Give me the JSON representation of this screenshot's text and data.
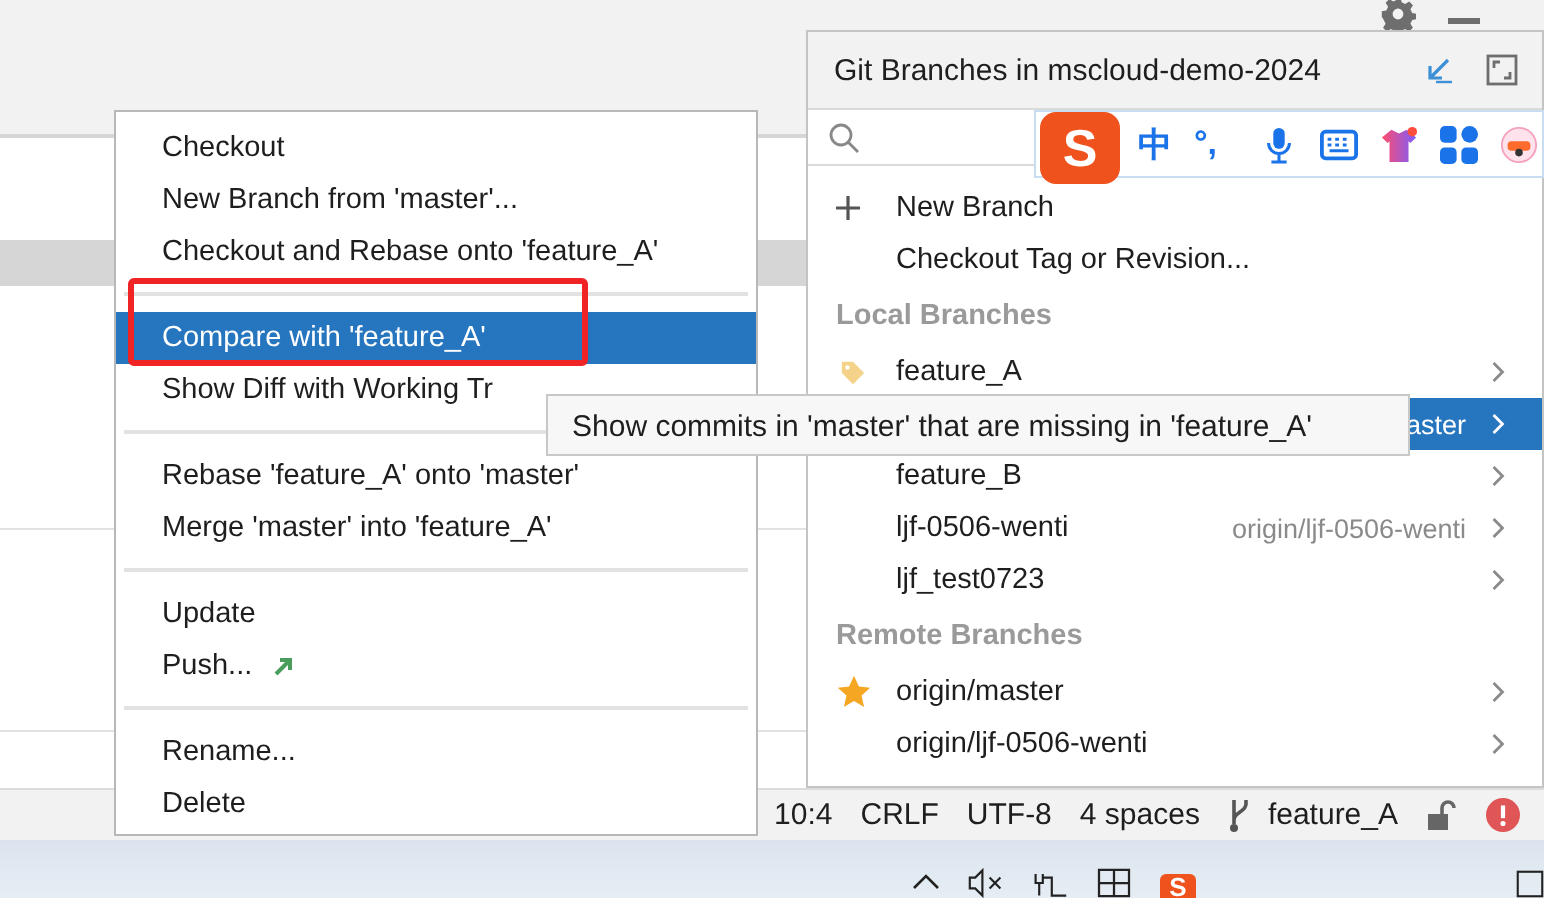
{
  "context_menu": {
    "groups": [
      {
        "items": [
          {
            "label": "Checkout",
            "selected": false
          },
          {
            "label": "New Branch from 'master'...",
            "selected": false
          },
          {
            "label": "Checkout and Rebase onto 'feature_A'",
            "selected": false
          }
        ]
      },
      {
        "items": [
          {
            "label": "Compare with 'feature_A'",
            "selected": true
          },
          {
            "label": "Show Diff with Working Tr",
            "selected": false
          }
        ]
      },
      {
        "items": [
          {
            "label": "Rebase 'feature_A' onto 'master'",
            "selected": false
          },
          {
            "label": "Merge 'master' into 'feature_A'",
            "selected": false
          }
        ]
      },
      {
        "items": [
          {
            "label": "Update",
            "selected": false
          },
          {
            "label": "Push...",
            "kind": "push",
            "selected": false
          }
        ]
      },
      {
        "items": [
          {
            "label": "Rename...",
            "selected": false
          },
          {
            "label": "Delete",
            "selected": false
          }
        ]
      }
    ]
  },
  "git_branches": {
    "title": "Git Branches in mscloud-demo-2024",
    "ime_toolbar": {
      "logo": "S",
      "mode": "中",
      "punctuation": "°,"
    },
    "actions": [
      {
        "label": "New Branch",
        "kind": "add"
      },
      {
        "label": "Checkout Tag or Revision...",
        "kind": "plain"
      }
    ],
    "sections": [
      {
        "title": "Local Branches",
        "branches": [
          {
            "name": "feature_A",
            "kind": "current",
            "selected": false
          },
          {
            "tracking": "aster",
            "selected": true
          },
          {
            "name": "feature_B",
            "selected": false
          },
          {
            "name": "ljf-0506-wenti",
            "tracking": "origin/ljf-0506-wenti",
            "selected": false
          },
          {
            "name": "ljf_test0723",
            "selected": false
          }
        ]
      },
      {
        "title": "Remote Branches",
        "branches": [
          {
            "name": "origin/master",
            "kind": "favorite",
            "selected": false
          },
          {
            "name": "origin/ljf-0506-wenti",
            "selected": false
          }
        ]
      }
    ]
  },
  "tooltip": {
    "text": "Show commits in 'master' that are missing in 'feature_A'"
  },
  "status_bar": {
    "items": [
      "10:4",
      "CRLF",
      "UTF-8",
      "4 spaces"
    ],
    "branch": "feature_A"
  },
  "taskbar": {
    "logo": "S"
  }
}
